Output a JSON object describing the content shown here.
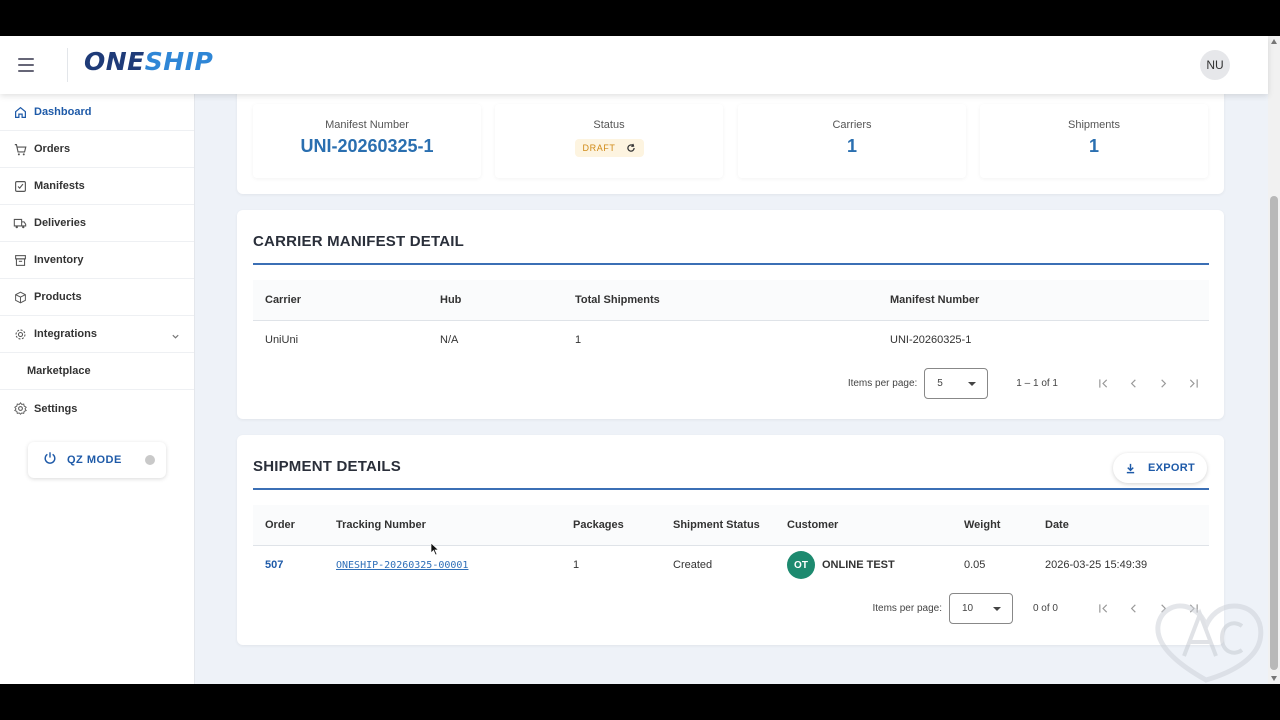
{
  "header": {
    "logo_part1": "ONE",
    "logo_part2": "SHIP",
    "avatar_initials": "NU"
  },
  "sidebar": {
    "items": [
      {
        "label": "Dashboard",
        "icon": "home-icon",
        "active": true
      },
      {
        "label": "Orders",
        "icon": "cart-icon"
      },
      {
        "label": "Manifests",
        "icon": "checklist-icon"
      },
      {
        "label": "Deliveries",
        "icon": "truck-icon"
      },
      {
        "label": "Inventory",
        "icon": "archive-box-icon"
      },
      {
        "label": "Products",
        "icon": "cube-icon"
      },
      {
        "label": "Integrations",
        "icon": "gear-cog-icon",
        "expandable": true
      },
      {
        "label": "Marketplace",
        "sub": true
      },
      {
        "label": "Settings",
        "icon": "settings-icon"
      }
    ],
    "qz_mode": {
      "label": "QZ MODE",
      "icon": "power-icon",
      "status": "off"
    }
  },
  "summary": {
    "manifest_number_caption": "Manifest Number",
    "manifest_number": "UNI-20260325-1",
    "status_caption": "Status",
    "status": "DRAFT",
    "carriers_caption": "Carriers",
    "carriers": "1",
    "shipments_caption": "Shipments",
    "shipments": "1"
  },
  "carrier_manifest": {
    "title": "CARRIER MANIFEST DETAIL",
    "columns": [
      "Carrier",
      "Hub",
      "Total Shipments",
      "Manifest Number"
    ],
    "rows": [
      [
        "UniUni",
        "N/A",
        "1",
        "UNI-20260325-1"
      ]
    ],
    "paginator": {
      "label": "Items per page:",
      "page_size": "5",
      "range": "1 – 1 of 1"
    }
  },
  "shipment_details": {
    "title": "SHIPMENT DETAILS",
    "export_label": "EXPORT",
    "columns": [
      "Order",
      "Tracking Number",
      "Packages",
      "Shipment Status",
      "Customer",
      "Weight",
      "Date"
    ],
    "rows": [
      {
        "order": "507",
        "tracking": "ONESHIP-20260325-00001",
        "packages": "1",
        "status": "Created",
        "customer_initials": "OT",
        "customer": "ONLINE TEST",
        "weight": "0.05",
        "date": "2026-03-25 15:49:39"
      }
    ],
    "paginator": {
      "label": "Items per page:",
      "page_size": "10",
      "range": "0 of 0"
    }
  },
  "colors": {
    "brand_dark": "#1f3b78",
    "brand_light": "#2f86d6",
    "accent": "#1e5aa8",
    "draft": "#d08a17",
    "customer_badge": "#1d8a6f"
  }
}
